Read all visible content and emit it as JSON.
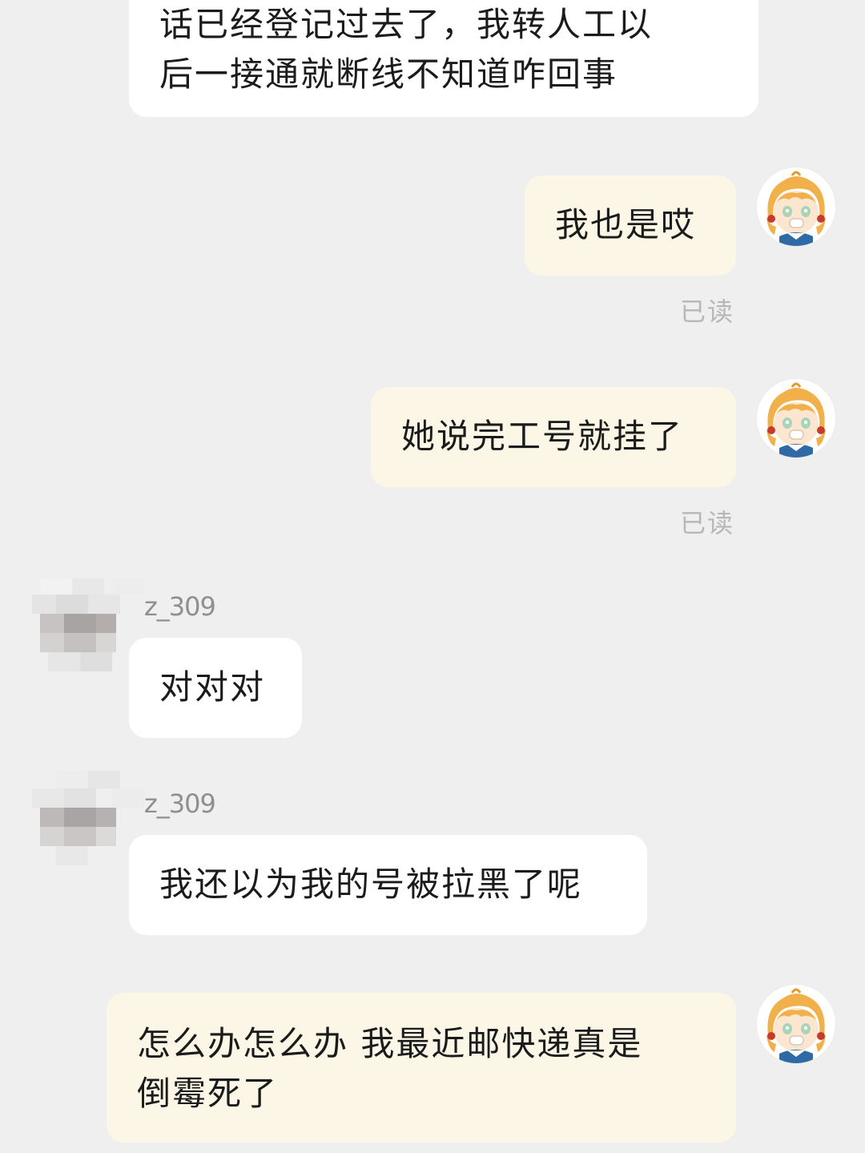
{
  "messages": [
    {
      "direction": "in",
      "lines": [
        "话已经登记过去了，我转人工以",
        "后一接通就断线不知道咋回事"
      ]
    },
    {
      "direction": "out",
      "text": "我也是哎",
      "status": "已读"
    },
    {
      "direction": "out",
      "text": "她说完工号就挂了",
      "status": "已读"
    },
    {
      "direction": "in",
      "sender": "z_309",
      "text": "对对对"
    },
    {
      "direction": "in",
      "sender": "z_309",
      "text": "我还以为我的号被拉黑了呢"
    },
    {
      "direction": "out",
      "lines": [
        "怎么办怎么办 我最近邮快递真是",
        "倒霉死了"
      ]
    }
  ],
  "colors": {
    "background": "#efefef",
    "incoming_bubble": "#ffffff",
    "outgoing_bubble": "#fcf6e6",
    "read_status": "#b7b7b7",
    "sender_name": "#8f8f8f"
  },
  "icons": {
    "self_avatar": "cartoon-girl-avatar-icon",
    "other_avatar": "pixelated-avatar-icon"
  }
}
